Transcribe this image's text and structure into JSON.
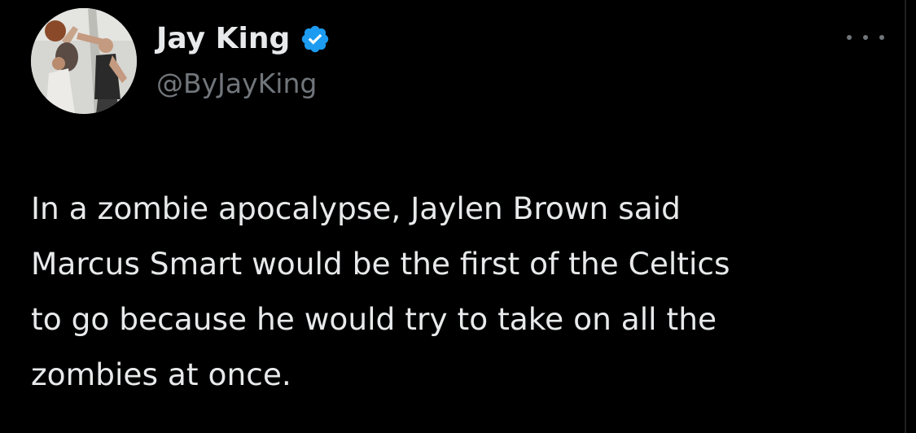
{
  "author": {
    "display_name": "Jay King",
    "handle": "@ByJayKing",
    "verified": true
  },
  "tweet": {
    "text": "In a zombie apocalypse, Jaylen Brown said\nMarcus Smart would be the first of the Celtics\nto go because he would try to take on all the\nzombies at once."
  },
  "icons": {
    "verified": "verified-badge-icon",
    "more": "more-options-icon"
  },
  "colors": {
    "background": "#000000",
    "text": "#e7e9ea",
    "secondary_text": "#71767b",
    "verified_blue": "#1d9bf0"
  }
}
